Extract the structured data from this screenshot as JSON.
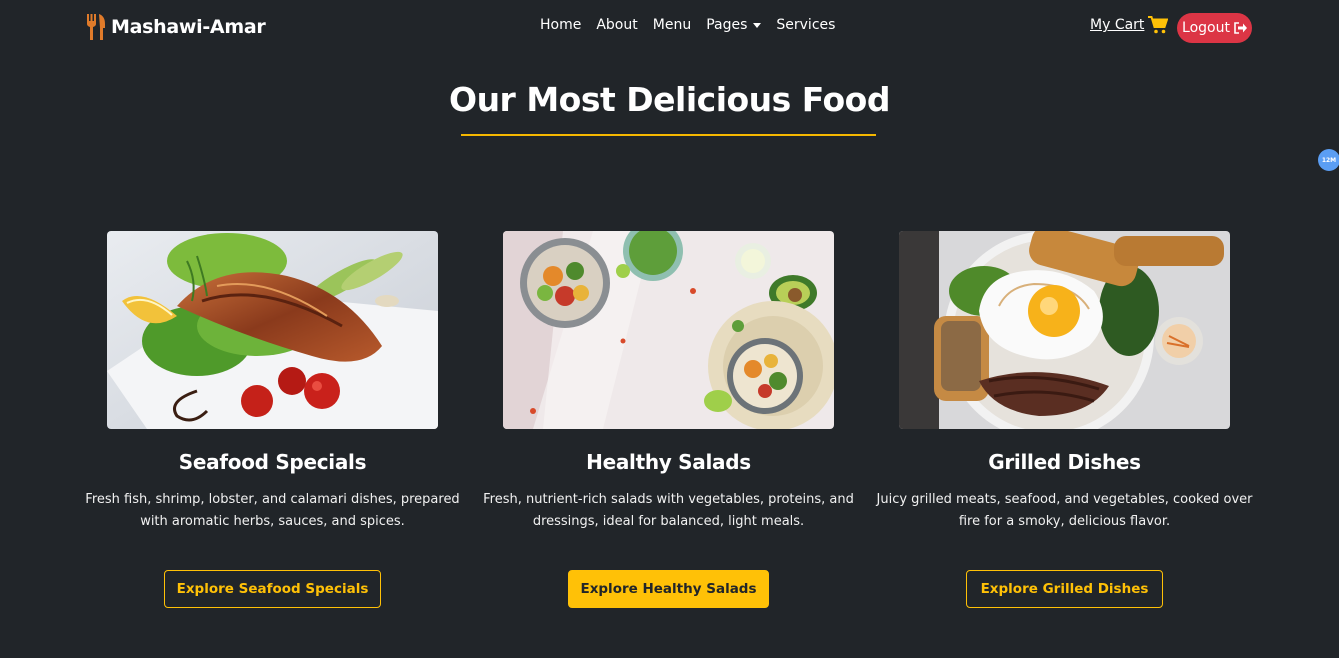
{
  "navbar": {
    "brand": "Mashawi-Amar",
    "brand_icon": "utensils-icon",
    "links": [
      {
        "label": "Home"
      },
      {
        "label": "About"
      },
      {
        "label": "Menu"
      },
      {
        "label": "Pages",
        "dropdown": true
      },
      {
        "label": "Services"
      }
    ],
    "cart_label": "My Cart",
    "cart_icon": "shopping-cart-icon",
    "logout_label": "Logout",
    "logout_icon": "sign-out-icon"
  },
  "side_badge": "12M",
  "section": {
    "title": "Our Most Delicious Food"
  },
  "cards": [
    {
      "title": "Seafood Specials",
      "description": "Fresh fish, shrimp, lobster, and calamari dishes, prepared with aromatic herbs, sauces, and spices.",
      "button": "Explore Seafood Specials",
      "button_style": "outline"
    },
    {
      "title": "Healthy Salads",
      "description": "Fresh, nutrient-rich salads with vegetables, proteins, and dressings, ideal for balanced, light meals.",
      "button": "Explore Healthy Salads",
      "button_style": "solid"
    },
    {
      "title": "Grilled Dishes",
      "description": "Juicy grilled meats, seafood, and vegetables, cooked over fire for a smoky, delicious flavor.",
      "button": "Explore Grilled Dishes",
      "button_style": "outline"
    }
  ],
  "colors": {
    "background": "#212529",
    "accent": "#ffc107",
    "danger": "#dc3545",
    "brand_icon": "#e07b2a",
    "badge": "#5b9ef3"
  }
}
